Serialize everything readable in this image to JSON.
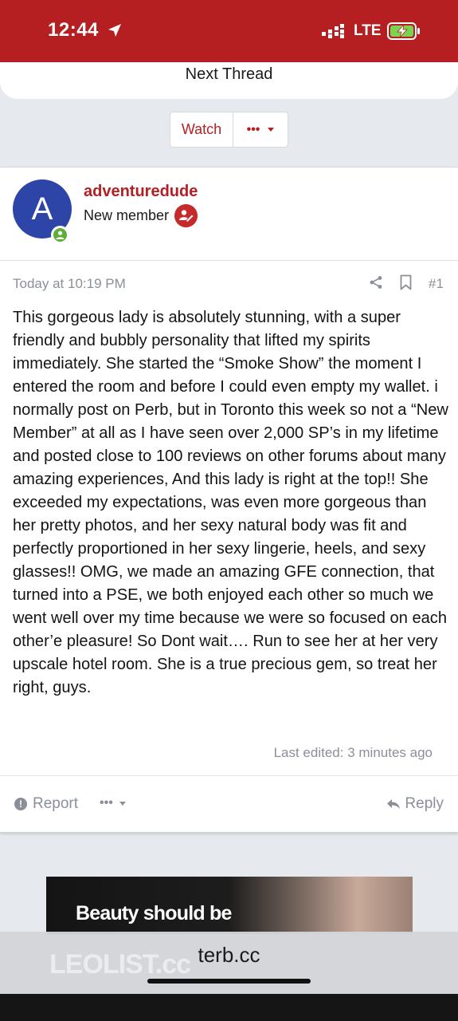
{
  "status_bar": {
    "time": "12:44",
    "network": "LTE",
    "icons": [
      "location-arrow-icon",
      "cellular-signal-icon",
      "battery-charging-icon"
    ]
  },
  "thread_nav": {
    "next_thread": "Next Thread"
  },
  "thread_actions": {
    "watch_label": "Watch",
    "more_label": "•••"
  },
  "post": {
    "author": {
      "avatar_letter": "A",
      "avatar_color": "#2e45a8",
      "username": "adventuredude",
      "title": "New member",
      "online": true
    },
    "timestamp": "Today at 10:19 PM",
    "number": "#1",
    "body": "This gorgeous lady is absolutely stunning, with a super friendly and bubbly personality that lifted my spirits immediately. She started the “Smoke Show” the moment I entered the room and before I could even empty my wallet. i normally post on Perb, but in Toronto this week so not a “New Member” at all as I have seen over 2,000 SP’s in my lifetime and posted close to 100 reviews on other forums about many amazing experiences, And this lady is right at the top!! She exceeded my expectations, was even more gorgeous than her pretty photos, and her sexy natural body was fit and perfectly proportioned in her sexy lingerie, heels, and sexy glasses!! OMG, we made an amazing GFE connection, that turned into a PSE, we both enjoyed each other so much we went well over my time because we were so focused on each other’e pleasure! So Dont wait…. Run to see her at her very upscale hotel room. She is a true precious gem, so treat her right, guys.",
    "last_edited": "Last edited: 3 minutes ago",
    "footer": {
      "report_label": "Report",
      "more_label": "•••",
      "reply_label": "Reply"
    }
  },
  "ad": {
    "headline": "Beauty should be"
  },
  "browser": {
    "url": "terb.cc",
    "background_text": "LEOLIST.cc"
  },
  "colors": {
    "brand_red": "#b61f22",
    "muted_gray": "#8a8f98",
    "page_bg": "#e6e9ee"
  }
}
